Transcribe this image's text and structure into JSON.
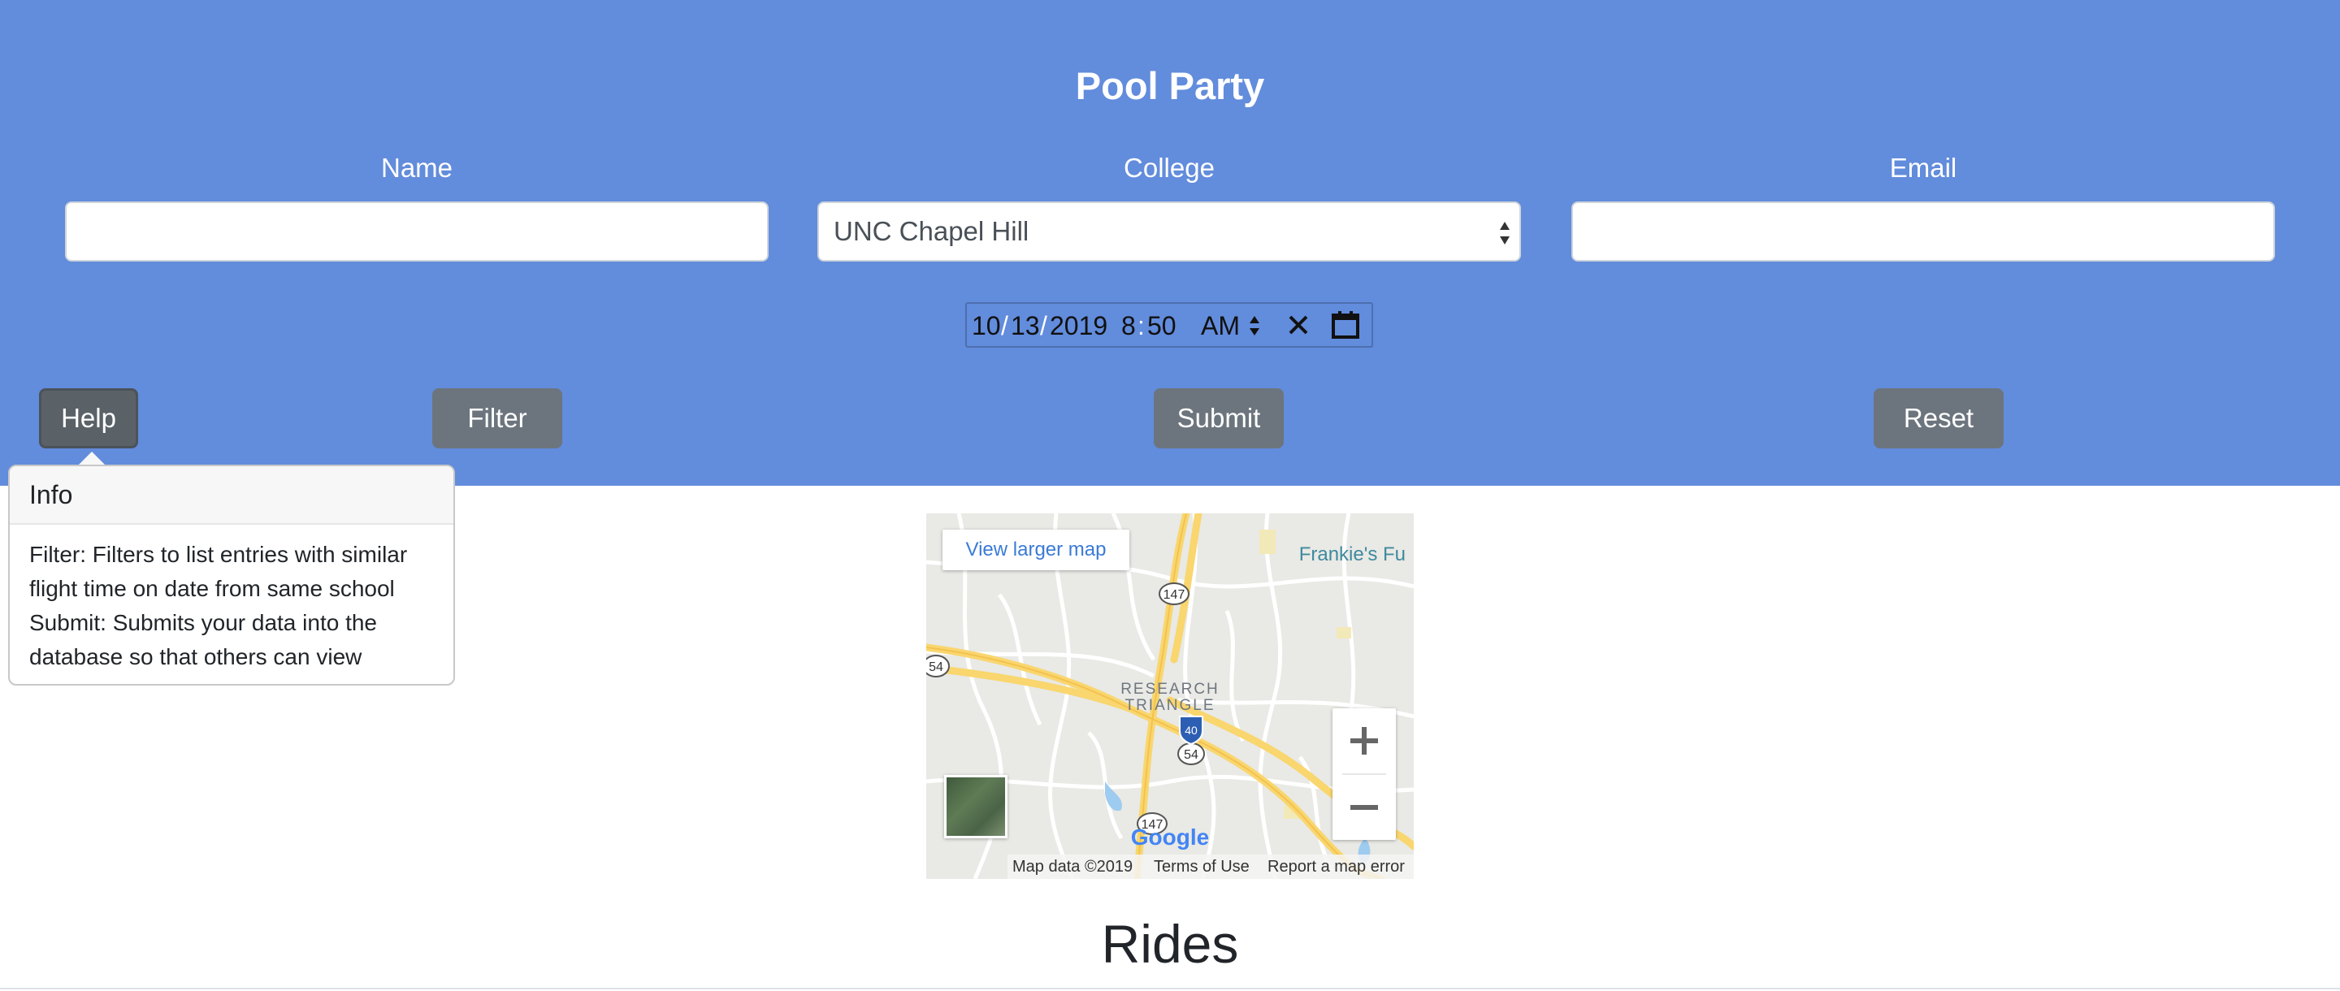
{
  "header": {
    "title": "Pool Party",
    "accent_color": "#628cdc"
  },
  "form": {
    "name_label": "Name",
    "name_value": "",
    "college_label": "College",
    "college_value": "UNC Chapel Hill",
    "email_label": "Email",
    "email_value": "",
    "datetime": {
      "month": "10",
      "day": "13",
      "year": "2019",
      "hour": "8",
      "minute": "50",
      "ampm": "AM",
      "clear_icon": "close-icon",
      "calendar_icon": "calendar-icon"
    }
  },
  "buttons": {
    "help": "Help",
    "filter": "Filter",
    "submit": "Submit",
    "reset": "Reset"
  },
  "popover": {
    "title": "Info",
    "lines": [
      "Filter: Filters to list entries with similar",
      "flight time on date from same school",
      "Submit: Submits your data into the",
      "database so that others can view"
    ]
  },
  "map": {
    "view_larger": "View larger map",
    "poi_label": "Frankie's Fu",
    "area_label_1": "RESEARCH",
    "area_label_2": "TRIANGLE",
    "route_147_top": "147",
    "route_147_bottom": "147",
    "route_54_left": "54",
    "route_54_mid": "54",
    "route_i40": "40",
    "brand": "Google",
    "map_data": "Map data ©2019",
    "terms": "Terms of Use",
    "report": "Report a map error"
  },
  "rides": {
    "heading": "Rides"
  }
}
